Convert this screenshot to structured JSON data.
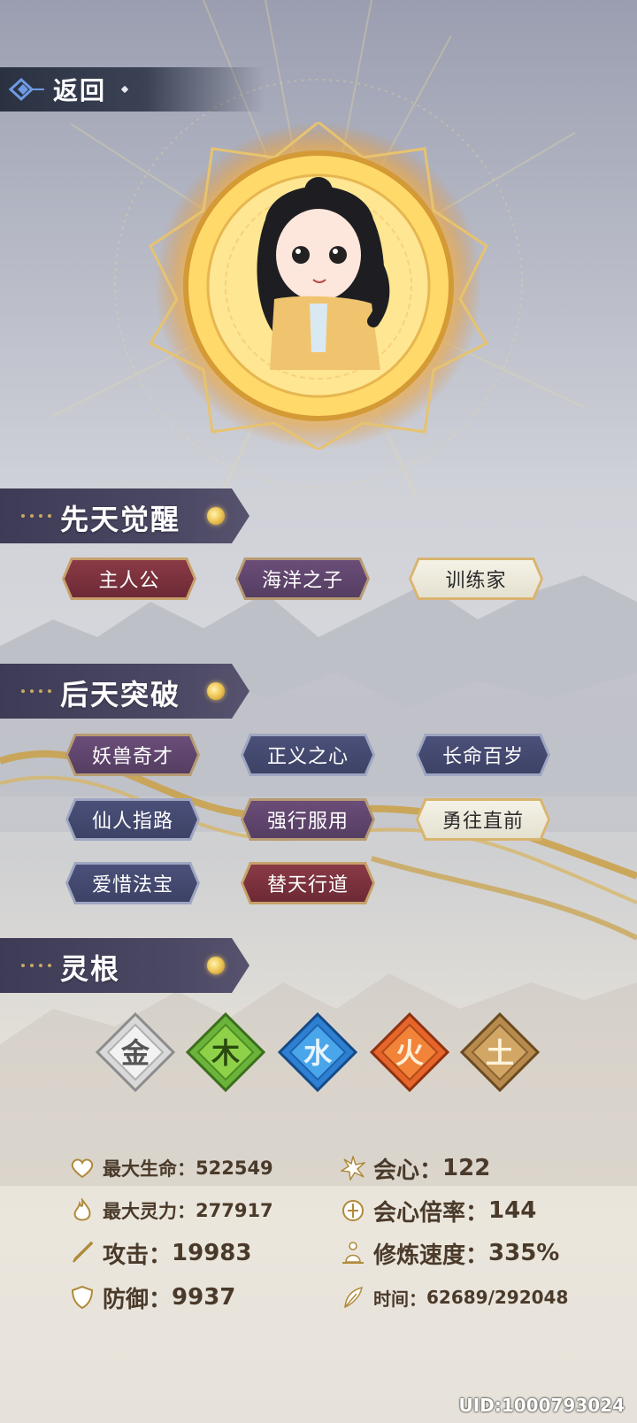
{
  "header": {
    "back_label": "返回"
  },
  "sections": {
    "innate": {
      "title": "先天觉醒",
      "tags": [
        "主人公",
        "海洋之子",
        "训练家"
      ]
    },
    "acquired": {
      "title": "后天突破",
      "tags": [
        "妖兽奇才",
        "正义之心",
        "长命百岁",
        "仙人指路",
        "强行服用",
        "勇往直前",
        "爱惜法宝",
        "替天行道"
      ]
    },
    "roots": {
      "title": "灵根",
      "elements": [
        "金",
        "木",
        "水",
        "火",
        "土"
      ]
    }
  },
  "stats": {
    "max_hp": {
      "label": "最大生命：",
      "value": "522549"
    },
    "max_mp": {
      "label": "最大灵力：",
      "value": "277917"
    },
    "attack": {
      "label": "攻击：",
      "value": "19983"
    },
    "defense": {
      "label": "防御：",
      "value": "9937"
    },
    "crit": {
      "label": "会心：",
      "value": "122"
    },
    "crit_rate": {
      "label": "会心倍率：",
      "value": "144"
    },
    "cultivation": {
      "label": "修炼速度：",
      "value": "335%"
    },
    "time": {
      "label": "时间：",
      "value": "62689/292048"
    }
  },
  "uid": "UID:1000793024",
  "colors": {
    "gold": "#e9b94a",
    "header_bg": "#3d3b55",
    "stat_text": "#4a3a2a"
  }
}
